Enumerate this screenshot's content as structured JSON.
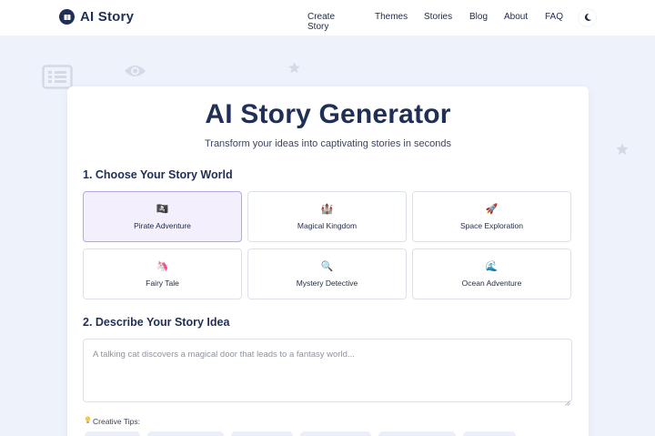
{
  "header": {
    "brand": "AI Story",
    "nav": [
      "Create Story",
      "Themes",
      "Stories",
      "Blog",
      "About",
      "FAQ"
    ]
  },
  "icons": {
    "logo": "book-icon",
    "theme_toggle": "moon-icon",
    "decorations": [
      "list-icon",
      "eye-icon",
      "star-icon",
      "star-icon"
    ]
  },
  "colors": {
    "brand": "#1f2f55",
    "selected_bg": "#f3effc",
    "selected_border": "#b7a6e6",
    "page_bg": "#eef2fb"
  },
  "main": {
    "title": "AI Story Generator",
    "subtitle": "Transform your ideas into captivating stories in seconds",
    "section1": "1. Choose Your Story World",
    "worlds": [
      {
        "emoji": "🏴‍☠️",
        "label": "Pirate Adventure",
        "selected": true
      },
      {
        "emoji": "🏰",
        "label": "Magical Kingdom",
        "selected": false
      },
      {
        "emoji": "🚀",
        "label": "Space Exploration",
        "selected": false
      },
      {
        "emoji": "🦄",
        "label": "Fairy Tale",
        "selected": false
      },
      {
        "emoji": "🔍",
        "label": "Mystery Detective",
        "selected": false
      },
      {
        "emoji": "🌊",
        "label": "Ocean Adventure",
        "selected": false
      }
    ],
    "section2": "2. Describe Your Story Idea",
    "idea_placeholder": "A talking cat discovers a magical door that leads to a fantasy world...",
    "tips_label": "Creative Tips:"
  }
}
